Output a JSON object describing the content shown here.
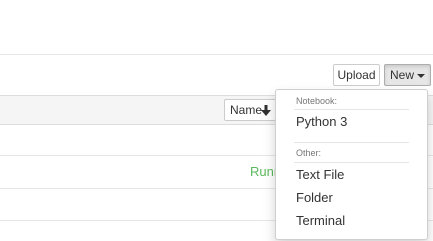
{
  "toolbar": {
    "upload_label": "Upload",
    "new_label": "New"
  },
  "list_header": {
    "name_sort_label": "Name"
  },
  "rows": [
    {
      "status": "Running"
    }
  ],
  "new_menu": {
    "notebook_header": "Notebook:",
    "notebook_items": [
      "Python 3"
    ],
    "other_header": "Other:",
    "other_items": [
      "Text File",
      "Folder",
      "Terminal"
    ]
  },
  "colors": {
    "running": "#5cb85c",
    "header_bg": "#f5f5f5",
    "new_active_bg": "#e6e6e6"
  }
}
